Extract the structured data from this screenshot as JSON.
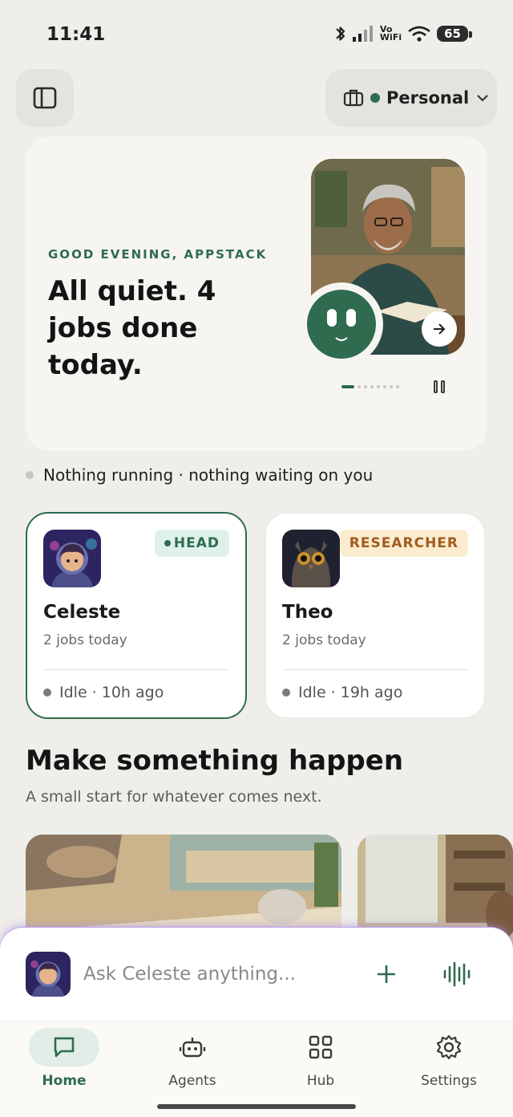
{
  "status_bar": {
    "time": "11:41",
    "battery": "65",
    "network_label": "Vo\nWiFi",
    "icons": [
      "bluetooth-icon",
      "signal-icon",
      "vowifi-icon",
      "wifi-icon",
      "battery-icon"
    ]
  },
  "header": {
    "sidebar_icon": "sidebar-panel-icon",
    "workspace_icon": "briefcase-icon",
    "workspace_label": "Personal",
    "workspace_status_color": "#2f6b4f"
  },
  "hero": {
    "greeting": "GOOD EVENING, APPSTACK",
    "headline": "All quiet. 4 jobs done today.",
    "carousel_total": 8,
    "carousel_active": 1
  },
  "activity": {
    "summary": "Nothing running · nothing waiting on you"
  },
  "agents": [
    {
      "name": "Celeste",
      "role": "HEAD",
      "jobs": "2 jobs today",
      "status": "Idle · 10h ago"
    },
    {
      "name": "Theo",
      "role": "RESEARCHER",
      "jobs": "2 jobs today",
      "status": "Idle · 19h ago"
    }
  ],
  "section": {
    "title": "Make something happen",
    "subtitle": "A small start for whatever comes next."
  },
  "ask_bar": {
    "placeholder": "Ask Celeste anything..."
  },
  "nav": {
    "items": [
      {
        "label": "Home",
        "icon": "chat-bubble-icon",
        "active": true
      },
      {
        "label": "Agents",
        "icon": "robot-icon",
        "active": false
      },
      {
        "label": "Hub",
        "icon": "grid-icon",
        "active": false
      },
      {
        "label": "Settings",
        "icon": "gear-icon",
        "active": false
      }
    ]
  },
  "colors": {
    "accent": "#2f6b4f",
    "background": "#efeeea",
    "researcher_badge": "#a35a1e"
  }
}
